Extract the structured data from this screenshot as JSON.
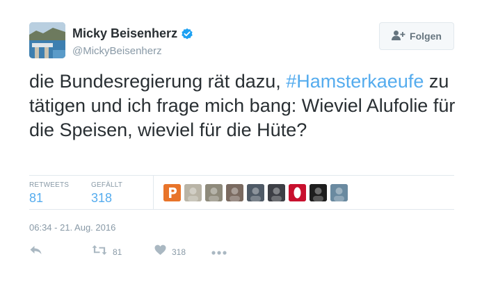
{
  "author": {
    "name": "Micky Beisenherz",
    "handle": "@MickyBeisenherz",
    "verified": true
  },
  "follow_button": {
    "label": "Folgen",
    "icon": "add-user-icon"
  },
  "tweet": {
    "text_before": "die Bundesregierung rät dazu, ",
    "hashtag": "#Hamsterkaeufe",
    "text_after": " zu tätigen und ich frage mich bang: Wieviel Alufolie für die Speisen, wieviel für die Hüte?"
  },
  "stats": {
    "retweets_label": "RETWEETS",
    "retweets_value": "81",
    "likes_label": "GEFÄLLT",
    "likes_value": "318"
  },
  "liker_avatars": [
    {
      "name": "liker-avatar-1",
      "color": "#e8742a"
    },
    {
      "name": "liker-avatar-2",
      "color": "#b9b4a6"
    },
    {
      "name": "liker-avatar-3",
      "color": "#8e8a7b"
    },
    {
      "name": "liker-avatar-4",
      "color": "#7a6a60"
    },
    {
      "name": "liker-avatar-5",
      "color": "#4f5a66"
    },
    {
      "name": "liker-avatar-6",
      "color": "#3d3f45"
    },
    {
      "name": "liker-avatar-7",
      "color": "#c8102e"
    },
    {
      "name": "liker-avatar-8",
      "color": "#1e1e1e"
    },
    {
      "name": "liker-avatar-9",
      "color": "#6a8aa0"
    }
  ],
  "timestamp": "06:34 - 21. Aug. 2016",
  "actions": {
    "reply_icon": "reply-icon",
    "retweet_icon": "retweet-icon",
    "retweet_count": "81",
    "like_icon": "heart-icon",
    "like_count": "318",
    "more_icon": "more-icon"
  },
  "colors": {
    "link": "#55acee",
    "muted": "#8899a6",
    "text": "#292f33",
    "border": "#e1e8ed"
  }
}
